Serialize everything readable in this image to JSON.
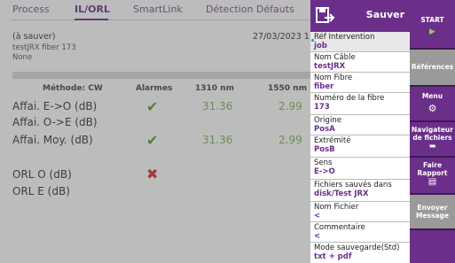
{
  "tabs": [
    "Process",
    "IL/ORL",
    "SmartLink",
    "Détection Défauts"
  ],
  "header": {
    "status": "(à sauver)",
    "file": "testJRX fiber 173",
    "note": "None",
    "date": "27/03/2023 1"
  },
  "table": {
    "method": "Méthode: CW",
    "col_alarms": "Alarmes",
    "col_1310": "1310 nm",
    "col_1550": "1550 nm",
    "rows": [
      {
        "label": "Affai. E->O (dB)",
        "v1310": "31.36",
        "v1550": "2.99"
      },
      {
        "label": "Affai. O->E (dB)",
        "v1310": "",
        "v1550": ""
      },
      {
        "label": "Affai. Moy. (dB)",
        "v1310": "31.36",
        "v1550": "2.99"
      },
      {
        "label": "ORL O (dB)",
        "v1310": "",
        "v1550": ""
      },
      {
        "label": "ORL E (dB)",
        "v1310": "",
        "v1550": ""
      }
    ]
  },
  "panel": {
    "save_label": "Sauver",
    "fields": [
      {
        "label": "Réf Intervention",
        "value": "job"
      },
      {
        "label": "Nom Câble",
        "value": "testJRX"
      },
      {
        "label": "Nom Fibre",
        "value": "fiber"
      },
      {
        "label": "Numéro de la fibre",
        "value": "173"
      },
      {
        "label": "Origine",
        "value": "PosA"
      },
      {
        "label": "Extrémité",
        "value": "PosB"
      },
      {
        "label": "Sens",
        "value": "E->O"
      },
      {
        "label": "Fichiers sauvés dans",
        "value": "disk/Test JRX"
      },
      {
        "label": "Nom Fichier",
        "value": "<"
      },
      {
        "label": "Commentaire",
        "value": "<"
      },
      {
        "label": "Mode sauvegarde(Std)",
        "value": "txt + pdf"
      }
    ]
  },
  "side": {
    "start": "START",
    "references": "Références",
    "menu": "Menu",
    "nav1": "Navigateur",
    "nav2": "de fichiers",
    "report1": "Faire",
    "report2": "Rapport",
    "send1": "Envoyer",
    "send2": "Message"
  },
  "colors": {
    "accent": "#6b2f8a",
    "dark": "#3b1a4f",
    "pass": "#5c9c35",
    "fail": "#d9302c"
  }
}
